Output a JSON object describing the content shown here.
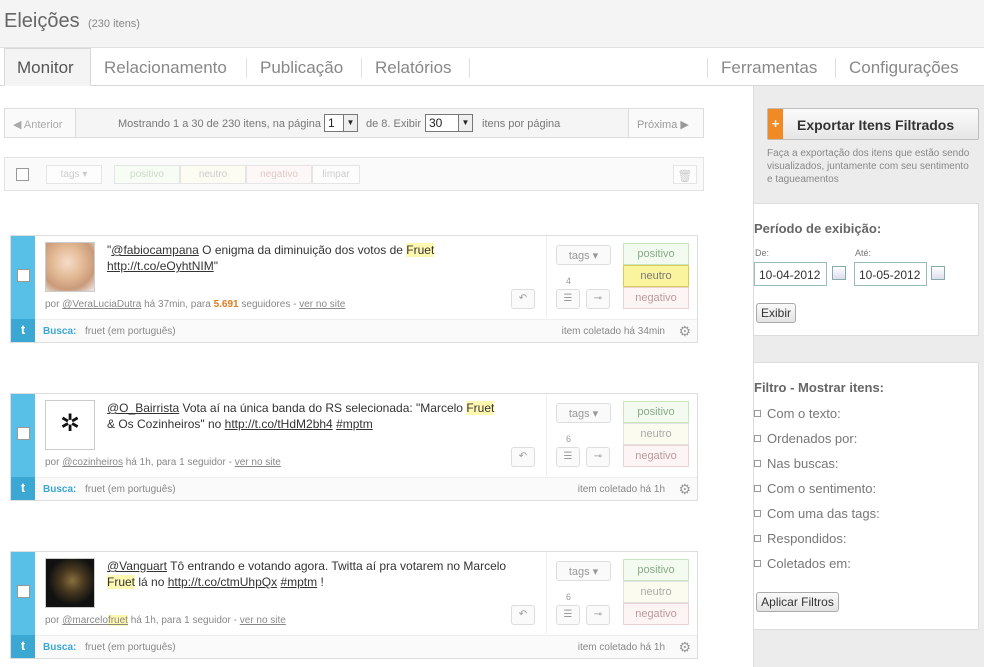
{
  "app": {
    "title": "Eleições",
    "count": "(230 itens)"
  },
  "tabs": [
    "Monitor",
    "Relacionamento",
    "Publicação",
    "Relatórios",
    "Ferramentas",
    "Configurações"
  ],
  "pagination": {
    "prev": "Anterior",
    "showing": "Mostrando 1 a 30 de 230 itens, na página",
    "page": "1",
    "of_pages": "de 8. Exibir",
    "per_page": "30",
    "per_page_label": "itens por página",
    "next": "Próxima"
  },
  "toolbar": {
    "tags": "tags ▾",
    "positive": "positivo",
    "neutral": "neutro",
    "negative": "negativo",
    "clear": "limpar"
  },
  "export": {
    "label": "Exportar Itens Filtrados",
    "plus": "+",
    "description": "Faça a exportação dos itens que estão sendo visualizados, juntamente com seu sentimento e tagueamentos"
  },
  "period": {
    "title": "Período de exibição:",
    "from_label": "De:",
    "from": "10-04-2012",
    "to_label": "Até:",
    "to": "10-05-2012",
    "button": "Exibir"
  },
  "filter": {
    "title": "Filtro - Mostrar itens:",
    "items": [
      "Com o texto:",
      "Ordenados por:",
      "Nas buscas:",
      "Com o sentimento:",
      "Com uma das tags:",
      "Respondidos:",
      "Coletados em:"
    ],
    "button": "Aplicar Filtros"
  },
  "tweets": [
    {
      "user": "@fabiocampana",
      "text1": "\"",
      "text2": " O enigma da diminuição dos votos de ",
      "hl": "Fruet",
      "link": "http://t.co/eOyhtNIM",
      "text3": "\"",
      "by": "por",
      "author": "@VeraLuciaDutra",
      "time": " há 37min, para ",
      "followers": "5.691",
      "followers_label": " seguidores - ",
      "site": "ver no site",
      "count": "4",
      "search_label": "Busca:",
      "search": "fruet (em português)",
      "collected": "item coletado há 34min",
      "sentiment": "neutro"
    },
    {
      "user": "@O_Bairrista",
      "text1": " Vota aí na única banda do RS selecionada: \"Marcelo ",
      "hl": "Fruet",
      "text2": " & Os Cozinheiros\" no ",
      "link": "http://t.co/tHdM2bh4",
      "hashtag": "#mptm",
      "by": "por",
      "author": "@cozinheiros",
      "time": " há 1h, para 1 seguidor - ",
      "site": "ver no site",
      "count": "6",
      "search_label": "Busca:",
      "search": "fruet (em português)",
      "collected": "item coletado há 1h"
    },
    {
      "user": "@Vanguart",
      "text1": " Tô entrando e votando agora. Twitta aí pra votarem no Marcelo ",
      "hl": "Fruet",
      "text2": " lá no ",
      "link": "http://t.co/ctmUhpQx",
      "hashtag": "#mptm",
      "text3": " !",
      "by": "por",
      "author_a": "@marcelo",
      "author_b": "fruet",
      "time": " há 1h, para 1 seguidor - ",
      "site": "ver no site",
      "count": "6",
      "search_label": "Busca:",
      "search": "fruet (em português)",
      "collected": "item coletado há 1h"
    }
  ],
  "icons": {
    "prev": "arrow-left-icon",
    "next": "arrow-right-icon",
    "reply": "reply-icon",
    "list": "list-icon",
    "settings": "gear-icon",
    "delete": "trash-icon",
    "twitter": "twitter-icon",
    "calendar": "calendar-icon"
  }
}
